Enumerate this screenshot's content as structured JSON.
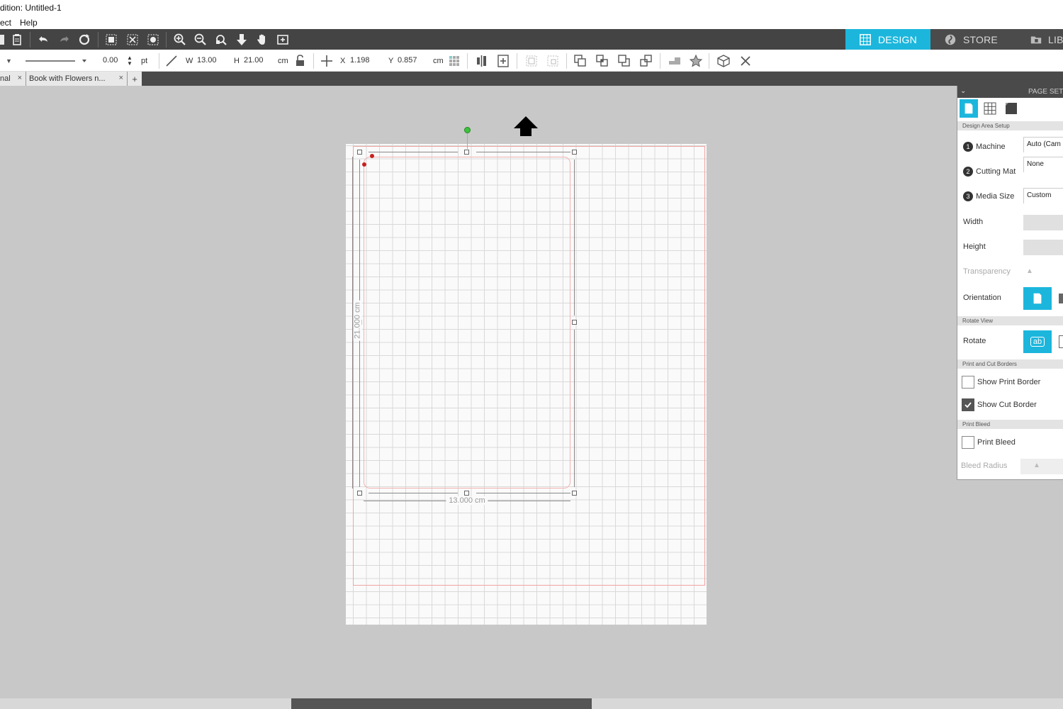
{
  "window": {
    "title": "dition: Untitled-1"
  },
  "menu": {
    "items": [
      "ect",
      "Help"
    ]
  },
  "nav": {
    "design": "DESIGN",
    "store": "STORE",
    "library": "LIB"
  },
  "props": {
    "line_weight": "0.00",
    "line_unit": "pt",
    "w_label": "W",
    "w_value": "13.00",
    "h_label": "H",
    "h_value": "21.00",
    "size_unit": "cm",
    "x_label": "X",
    "x_value": "1.198",
    "y_label": "Y",
    "y_value": "0.857",
    "pos_unit": "cm"
  },
  "tabs": [
    {
      "label": "nal"
    },
    {
      "label": "Book with Flowers n..."
    }
  ],
  "tab_close": "×",
  "tab_add": "+",
  "canvas": {
    "width_dim": "13.000 cm",
    "height_dim": "21.000 cm"
  },
  "panel": {
    "title": "PAGE SET",
    "section_design_area": "Design Area Setup",
    "machine_label": "Machine",
    "machine_value": "Auto (Cam",
    "mat_label": "Cutting Mat",
    "mat_value": "None",
    "media_label": "Media Size",
    "media_value": "Custom",
    "width_label": "Width",
    "height_label": "Height",
    "transparency_label": "Transparency",
    "orientation_label": "Orientation",
    "section_rotate": "Rotate View",
    "rotate_label": "Rotate",
    "rotate_btn": "ab",
    "section_borders": "Print and Cut Borders",
    "show_print_border": "Show Print Border",
    "show_cut_border": "Show Cut Border",
    "show_print_border_checked": false,
    "show_cut_border_checked": true,
    "section_bleed": "Print Bleed",
    "print_bleed": "Print Bleed",
    "print_bleed_checked": false,
    "bleed_radius_label": "Bleed Radius",
    "num1": "1",
    "num2": "2",
    "num3": "3"
  },
  "colors": {
    "accent": "#1cb6dc",
    "toolbar_dark": "#444444",
    "canvas_bg": "#c8c8c8",
    "cut_border": "#f0a3a3"
  }
}
